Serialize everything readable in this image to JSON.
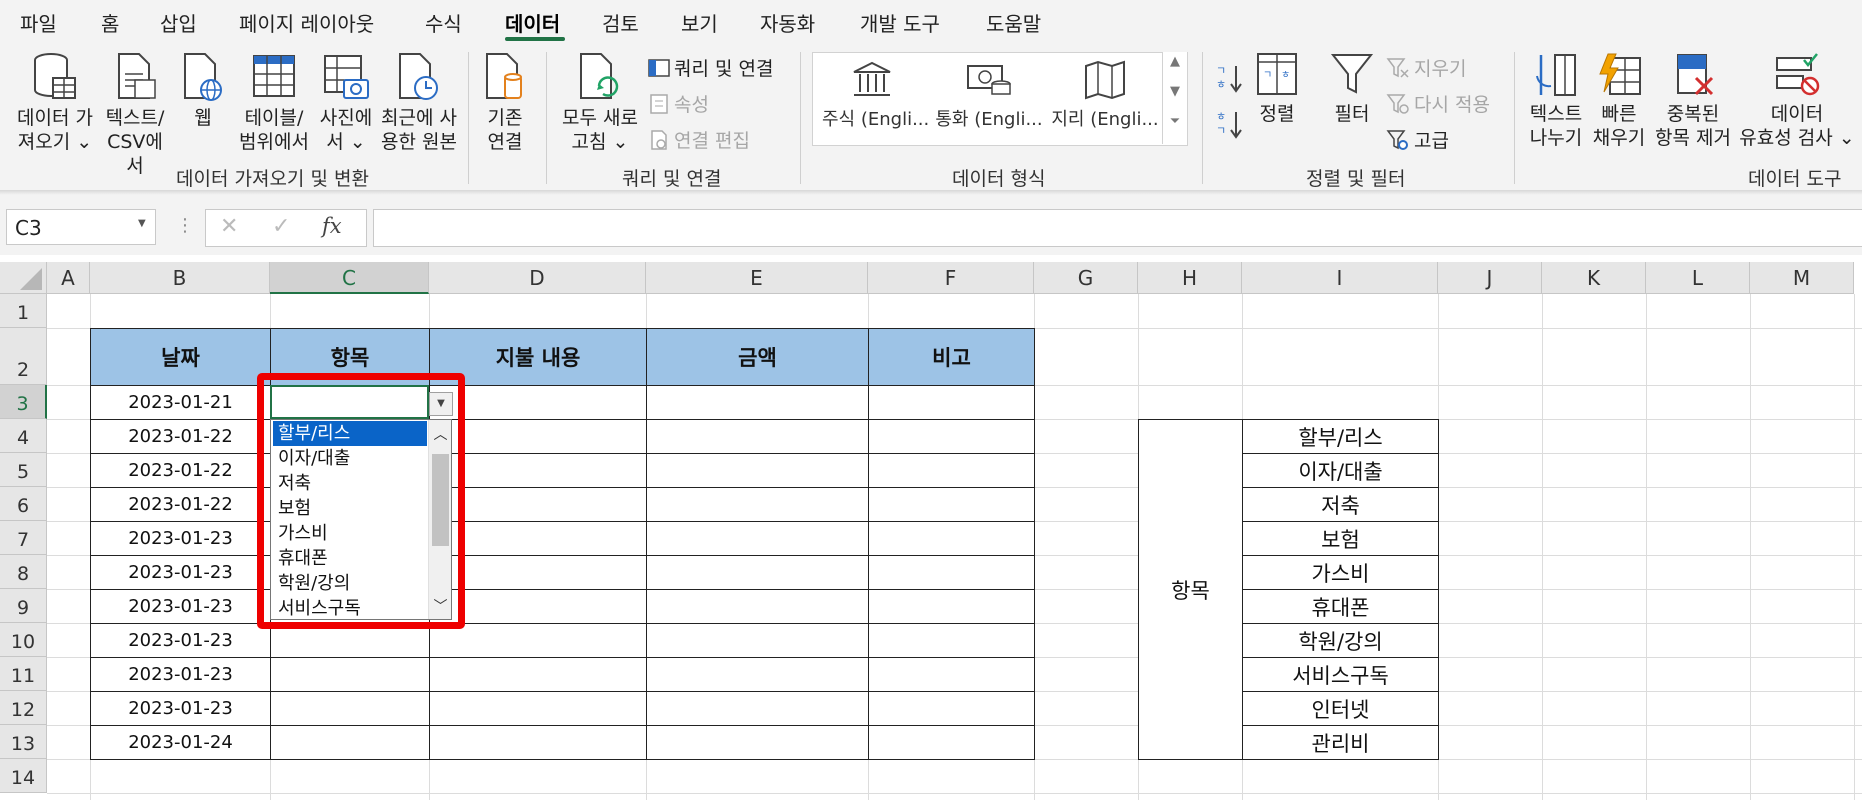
{
  "tabs": [
    {
      "label": "파일"
    },
    {
      "label": "홈"
    },
    {
      "label": "삽입"
    },
    {
      "label": "페이지 레이아웃"
    },
    {
      "label": "수식"
    },
    {
      "label": "데이터"
    },
    {
      "label": "검토"
    },
    {
      "label": "보기"
    },
    {
      "label": "자동화"
    },
    {
      "label": "개발 도구"
    },
    {
      "label": "도움말"
    }
  ],
  "ribbon": {
    "get_data": {
      "line1": "데이터 가",
      "line2": "져오기 ⌄"
    },
    "text_csv": {
      "line1": "텍스트/",
      "line2": "CSV에서"
    },
    "web": {
      "line1": "웹"
    },
    "table_range": {
      "line1": "테이블/",
      "line2": "범위에서"
    },
    "from_picture": {
      "line1": "사진에",
      "line2": "서 ⌄"
    },
    "recent_sources": {
      "line1": "최근에 사",
      "line2": "용한 원본"
    },
    "existing_conn": {
      "line1": "기존",
      "line2": "연결"
    },
    "refresh_all": {
      "line1": "모두 새로",
      "line2": "고침 ⌄"
    },
    "queries_conn": "쿼리 및 연결",
    "properties": "속성",
    "edit_links": "연결 편집",
    "stocks": "주식 (Engli...",
    "currency": "통화 (Engli...",
    "geography": "지리 (Engli...",
    "sort": "정렬",
    "filter": "필터",
    "clear": "지우기",
    "reapply": "다시 적용",
    "advanced": "고급",
    "text_to_columns": {
      "line1": "텍스트",
      "line2": "나누기"
    },
    "flash_fill": {
      "line1": "빠른",
      "line2": "채우기"
    },
    "remove_dup": {
      "line1": "중복된",
      "line2": "항목 제거"
    },
    "data_validation": {
      "line1": "데이터",
      "line2": "유효성 검사 ⌄"
    },
    "groups": {
      "get_transform": "데이터 가져오기 및 변환",
      "queries": "쿼리 및 연결",
      "data_types": "데이터 형식",
      "sort_filter": "정렬 및 필터",
      "data_tools": "데이터 도구"
    }
  },
  "formula_bar": {
    "name_box": "C3",
    "fx": "fx",
    "formula": ""
  },
  "sheet": {
    "columns": [
      "A",
      "B",
      "C",
      "D",
      "E",
      "F",
      "G",
      "H",
      "I",
      "J",
      "K",
      "L",
      "M"
    ],
    "rows": [
      "1",
      "2",
      "3",
      "4",
      "5",
      "6",
      "7",
      "8",
      "9",
      "10",
      "11",
      "12",
      "13",
      "14"
    ],
    "headers": [
      "날짜",
      "항목",
      "지불 내용",
      "금액",
      "비고"
    ],
    "dates": [
      "2023-01-21",
      "2023-01-22",
      "2023-01-22",
      "2023-01-22",
      "2023-01-23",
      "2023-01-23",
      "2023-01-23",
      "2023-01-23",
      "2023-01-23",
      "2023-01-23",
      "2023-01-24"
    ],
    "ref_label": "항목",
    "ref_items": [
      "할부/리스",
      "이자/대출",
      "저축",
      "보험",
      "가스비",
      "휴대폰",
      "학원/강의",
      "서비스구독",
      "인터넷",
      "관리비"
    ]
  },
  "dropdown": {
    "items": [
      "할부/리스",
      "이자/대출",
      "저축",
      "보험",
      "가스비",
      "휴대폰",
      "학원/강의",
      "서비스구독"
    ],
    "selected_index": 0
  },
  "colors": {
    "header_fill": "#9dc3e6",
    "accent": "#217346",
    "highlight": "#ee0000",
    "selection": "#0a64c8"
  }
}
